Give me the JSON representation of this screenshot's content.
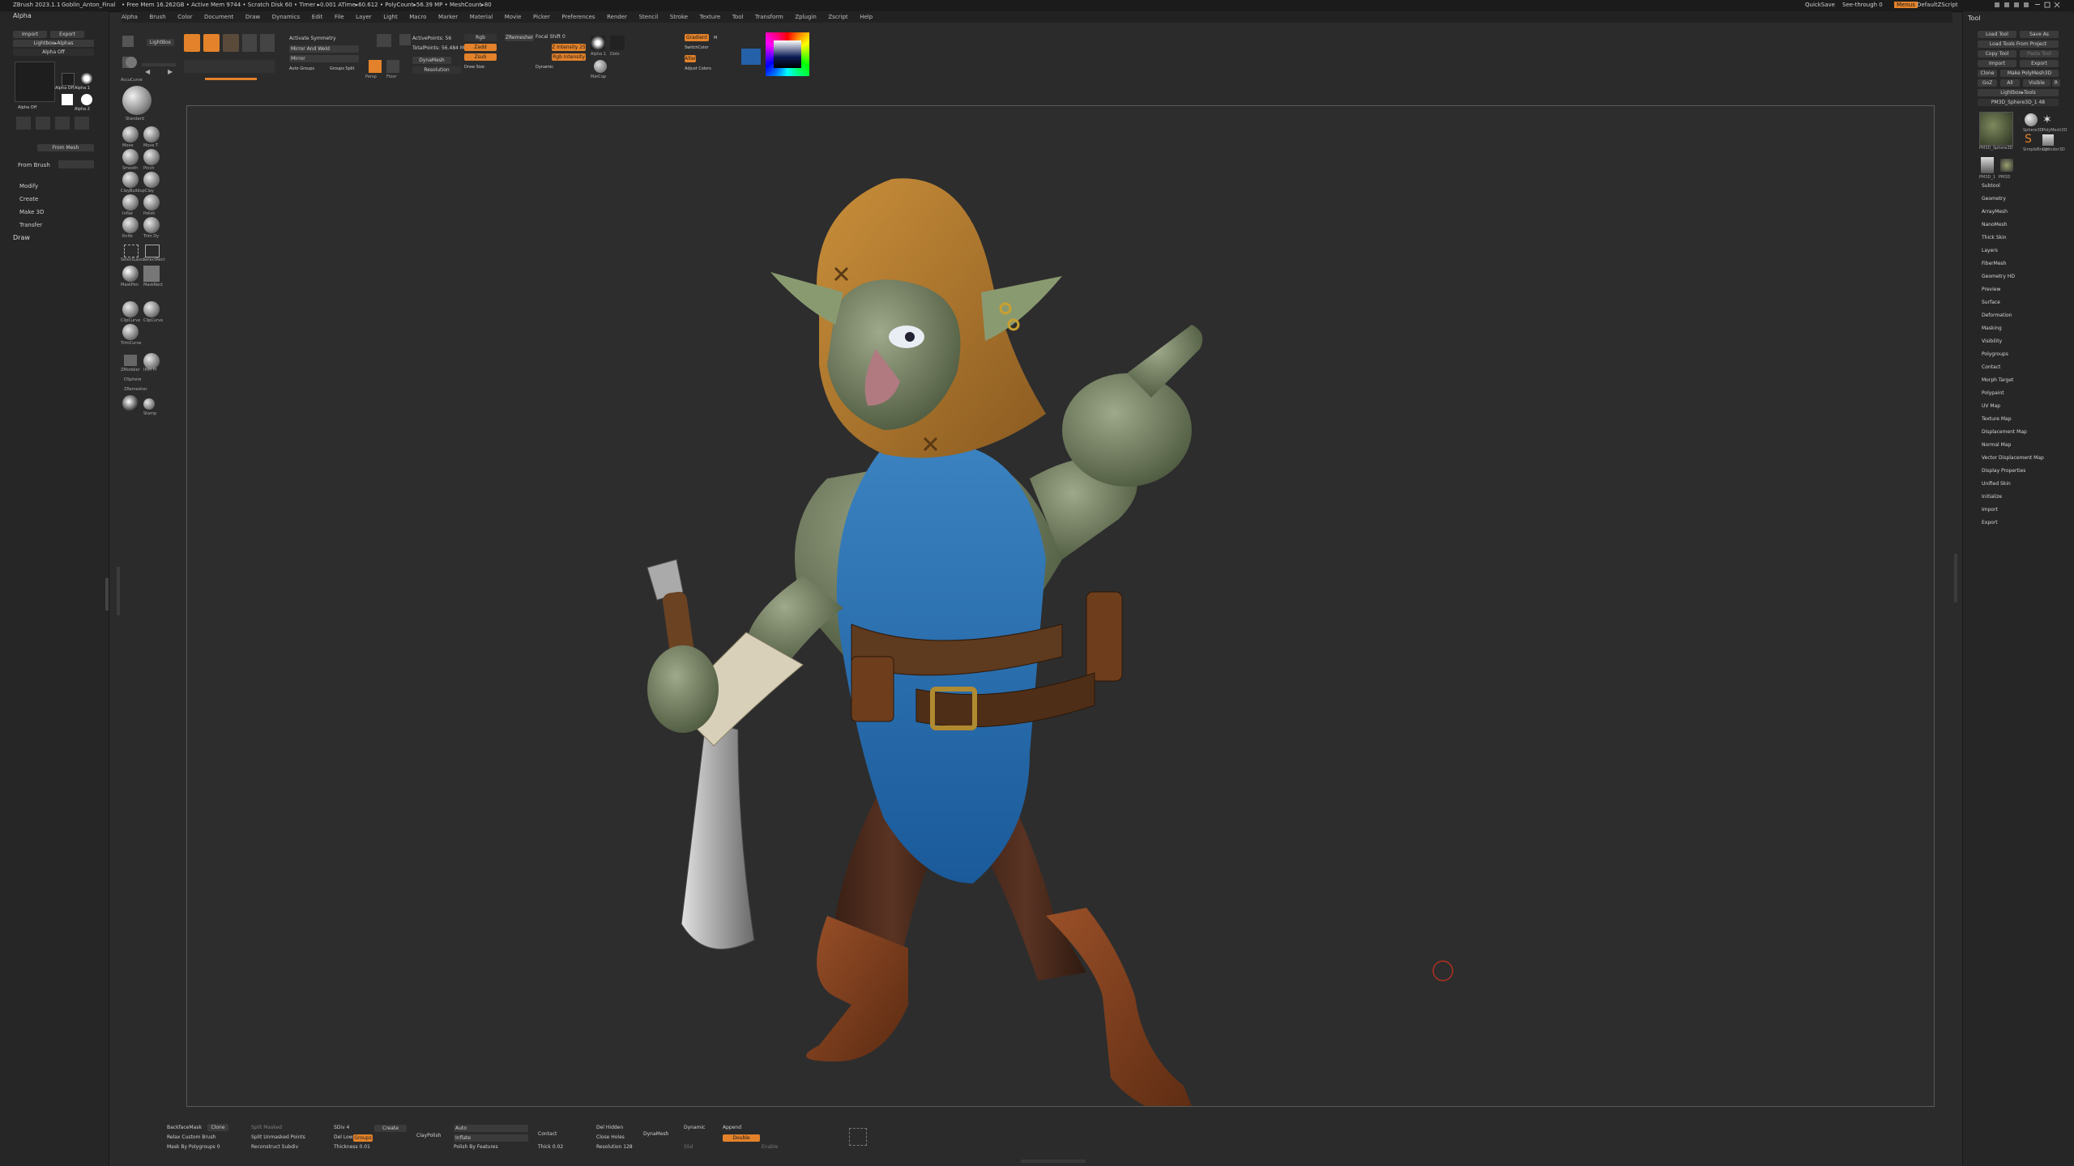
{
  "titlebar": {
    "app": "ZBrush 2023.1.1",
    "project": "Goblin_Anton_Final",
    "stats": "• Free Mem 16.262GB • Active Mem 9744 • Scratch Disk 60 • Timer ▸0.001 ATime▸60.612 • PolyCount▸56.39 MP • MeshCount▸80",
    "quicksave": "QuickSave",
    "seethrough": "See-through 0",
    "menus": "Menus",
    "script": "DefaultZScript"
  },
  "menubar": [
    "Alpha",
    "Brush",
    "Color",
    "Document",
    "Draw",
    "Dynamics",
    "Edit",
    "File",
    "Layer",
    "Light",
    "Macro",
    "Marker",
    "Material",
    "Movie",
    "Picker",
    "Preferences",
    "Render",
    "Stencil",
    "Stroke",
    "Texture",
    "Tool",
    "Transform",
    "Zplugin",
    "Zscript",
    "Help"
  ],
  "left": {
    "title": "Alpha",
    "import": "Import",
    "export": "Export",
    "lightbox": "Lightbox▸Alphas",
    "alpha_off": "Alpha Off",
    "alpha_items": [
      "Alpha Off",
      "Alpha 1",
      "Alpha 2"
    ],
    "from_mesh": "From Mesh",
    "from_brush": "From Brush",
    "sections": [
      "Modify",
      "Create",
      "Make 3D",
      "Transfer"
    ],
    "draw": "Draw"
  },
  "shelf": {
    "lightbox": "LightBox",
    "activate_symmetry": "Activate Symmetry",
    "mirror_weld": "Mirror And Weld",
    "mirror": "Mirror",
    "auto_groups": "Auto Groups",
    "groups_split": "Groups Split",
    "active_points": "ActivePoints: 56",
    "total_points": "TotalPoints: 56.484 Mil",
    "dynamesh": "DynaMesh",
    "zremesher": "ZRemesher",
    "resolution": "Resolution",
    "persp": "Persp",
    "floor": "Floor",
    "draw_size": "Draw Size",
    "dynamic": "Dynamic",
    "focal_shift": "Focal Shift 0",
    "z_intensity": "Z Intensity 25",
    "rgb": "Rgb",
    "m": "M",
    "zadd": "Zadd",
    "zsub": "Zsub",
    "zcut": "Zcut",
    "rgb_intensity": "Rgb Intensity",
    "alpha": "Alpha 1",
    "stroke": "Dots",
    "matcap": "MatCap",
    "adjust_colors": "Adjust Colors",
    "gradient": "Gradient",
    "switch_color": "SwitchColor",
    "alternate": "Alternate"
  },
  "brushes": [
    "AccuCurve",
    "Standard",
    "Move",
    "Move T",
    "Smooth",
    "Pinch",
    "ClayBuildup",
    "Clay",
    "Inflat",
    "Polish",
    "Knife",
    "Trim Dy",
    "SelectLasso",
    "SelectRect",
    "MaskPen",
    "MaskRect",
    "ClipCurve",
    "ClipCurve",
    "TrimCurve",
    "ZModeler",
    "IMM Pr",
    "DSphere",
    "ZRemesher",
    "Stamp"
  ],
  "right": {
    "title": "Tool",
    "load_tool": "Load Tool",
    "save_as": "Save As",
    "load_tools_project": "Load Tools From Project",
    "copy_tool": "Copy Tool",
    "paste_tool": "Paste Tool",
    "import": "Import",
    "export": "Export",
    "clone": "Clone",
    "make_polymesh": "Make PolyMesh3D",
    "goz": "GoZ",
    "all": "All",
    "visible": "Visible",
    "r": "R",
    "lightbox_tools": "Lightbox▸Tools",
    "current_tool": "PM3D_Sphere3D_1 48",
    "tool_thumbs": [
      "PM3D_Sphere3D",
      "Sphere3D",
      "PolyMesh3D",
      "SimpleBrush",
      "Cylinder3D",
      "PM3D_1",
      "PM3D"
    ],
    "subpalettes": [
      "Subtool",
      "Geometry",
      "ArrayMesh",
      "NanoMesh",
      "Thick Skin",
      "Layers",
      "FiberMesh",
      "Geometry HD",
      "Preview",
      "Surface",
      "Deformation",
      "Masking",
      "Visibility",
      "Polygroups",
      "Contact",
      "Morph Target",
      "Polypaint",
      "UV Map",
      "Texture Map",
      "Displacement Map",
      "Normal Map",
      "Vector Displacement Map",
      "Display Properties",
      "Unified Skin",
      "Initialize",
      "Import",
      "Export"
    ]
  },
  "bottom": {
    "backface": "BackfaceMask",
    "clone": "Clone",
    "split_masked": "Split Masked",
    "apply_brush": "Relax Custom Brush",
    "split_unmasked": "Split Unmasked Points",
    "polygroup": "Mask By Polygroups 0",
    "reconstruct": "Reconstruct Subdiv",
    "thickness": "Thickness 0.01",
    "create": "Create",
    "zsphere": "Auto",
    "inflate": "Inflate",
    "polish_feat": "Polish By Features",
    "contact": "Contact",
    "del_hidden": "Del Hidden",
    "close_holes": "Close Holes",
    "thick": "Thick 0.02",
    "resolution": "Resolution 128",
    "dynamic": "Dynamic",
    "append": "Append",
    "double": "Double",
    "enable": "Enable",
    "claypolish": "ClayPolish",
    "dynamesh_label": "DynaMesh",
    "groups": "Groups",
    "ssd": "SSd",
    "del_lower": "Del Lower",
    "sdiv": "SDiv 4"
  },
  "colors": {
    "accent": "#e3822a",
    "bg": "#2b2b2b",
    "panel": "#262626",
    "viewport_border": "#5a5a5a"
  }
}
